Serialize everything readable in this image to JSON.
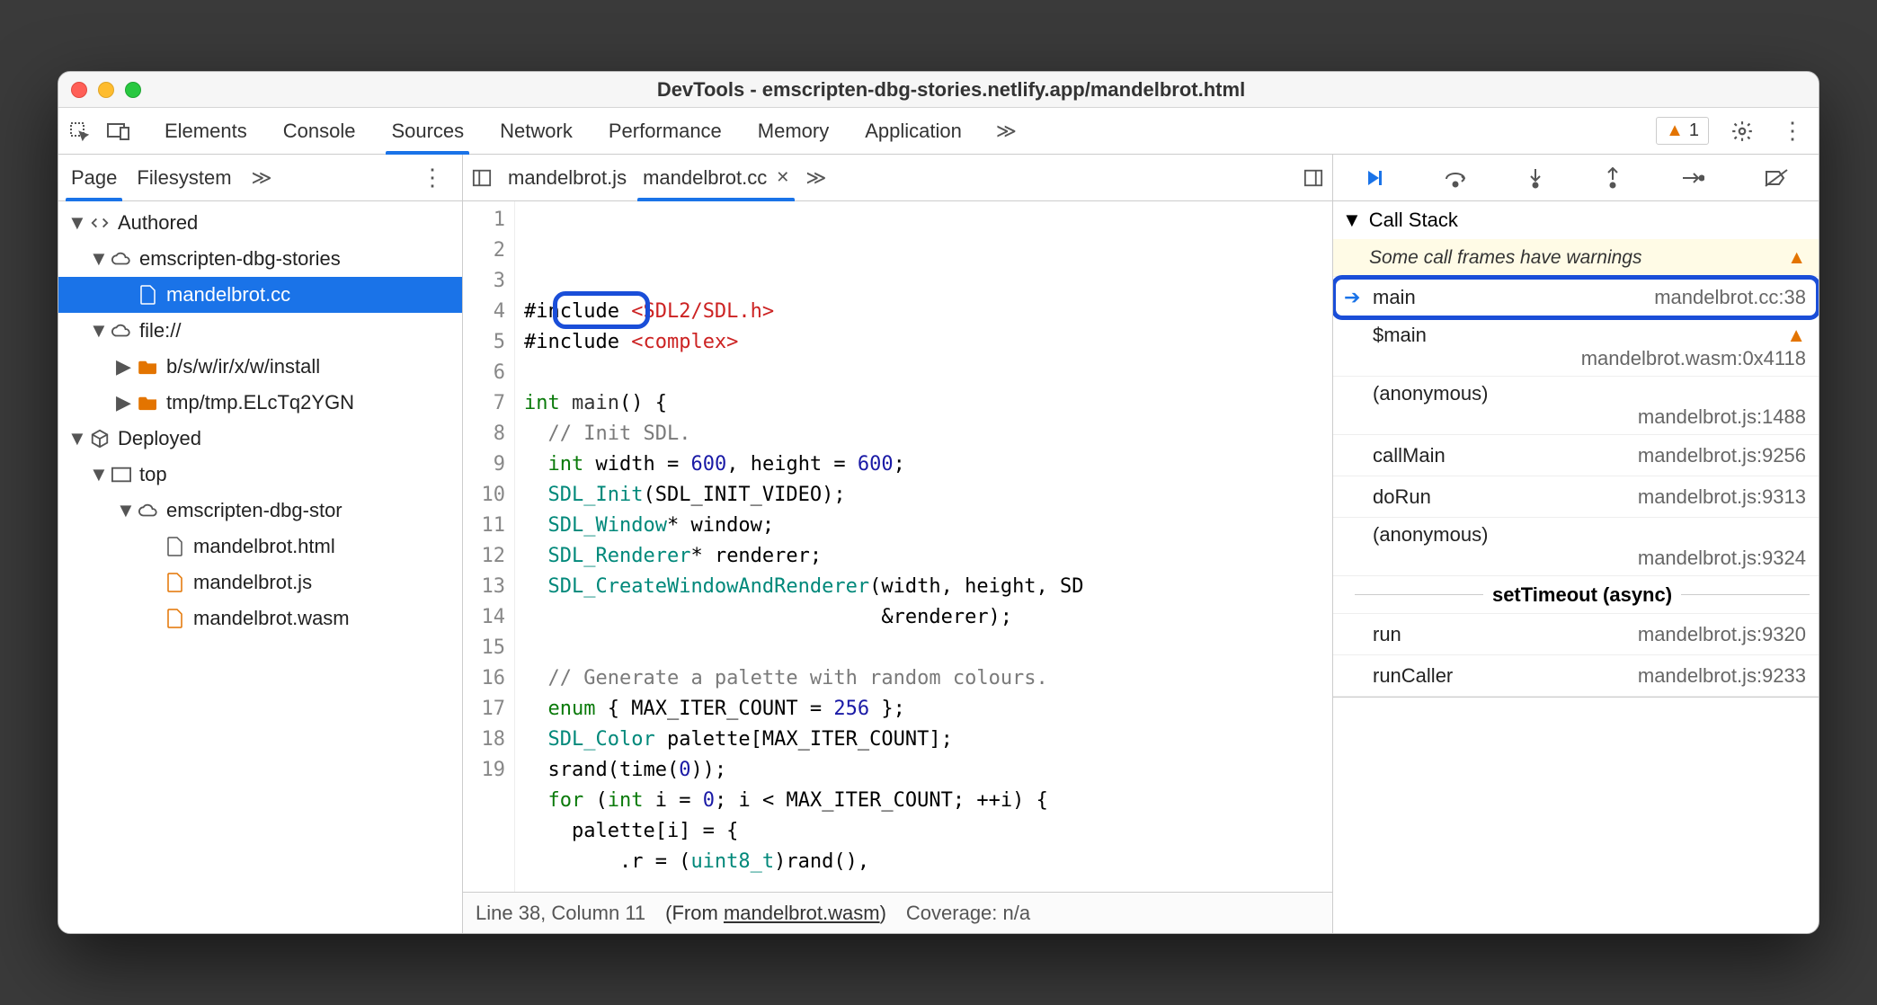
{
  "window": {
    "title": "DevTools - emscripten-dbg-stories.netlify.app/mandelbrot.html"
  },
  "mainTabs": [
    "Elements",
    "Console",
    "Sources",
    "Network",
    "Performance",
    "Memory",
    "Application"
  ],
  "mainTabActive": 2,
  "warnings": {
    "count": "1"
  },
  "leftTabs": [
    "Page",
    "Filesystem"
  ],
  "leftTabActive": 0,
  "tree": {
    "authored": "Authored",
    "origin1": "emscripten-dbg-stories",
    "file1": "mandelbrot.cc",
    "origin2": "file://",
    "folder1": "b/s/w/ir/x/w/install",
    "folder2": "tmp/tmp.ELcTq2YGN",
    "deployed": "Deployed",
    "top": "top",
    "origin3": "emscripten-dbg-stor",
    "dfile1": "mandelbrot.html",
    "dfile2": "mandelbrot.js",
    "dfile3": "mandelbrot.wasm"
  },
  "fileTabs": [
    {
      "label": "mandelbrot.js",
      "active": false,
      "close": false
    },
    {
      "label": "mandelbrot.cc",
      "active": true,
      "close": true
    }
  ],
  "code": {
    "lines": [
      {
        "n": 1,
        "html": "#include <span class='s-pp'>&lt;SDL2/SDL.h&gt;</span>"
      },
      {
        "n": 2,
        "html": "#include <span class='s-pp'>&lt;complex&gt;</span>"
      },
      {
        "n": 3,
        "html": ""
      },
      {
        "n": 4,
        "html": "<span class='s-kw'>int</span> <span class='s-fn'>main</span>() {"
      },
      {
        "n": 5,
        "html": "  <span class='s-cm'>// Init SDL.</span>"
      },
      {
        "n": 6,
        "html": "  <span class='s-kw'>int</span> width = <span class='s-nu'>600</span>, height = <span class='s-nu'>600</span>;"
      },
      {
        "n": 7,
        "html": "  <span class='s-ty'>SDL_Init</span>(SDL_INIT_VIDEO);"
      },
      {
        "n": 8,
        "html": "  <span class='s-ty'>SDL_Window</span>* window;"
      },
      {
        "n": 9,
        "html": "  <span class='s-ty'>SDL_Renderer</span>* renderer;"
      },
      {
        "n": 10,
        "html": "  <span class='s-ty'>SDL_CreateWindowAndRenderer</span>(width, height, SD"
      },
      {
        "n": 11,
        "html": "                              &amp;renderer);"
      },
      {
        "n": 12,
        "html": ""
      },
      {
        "n": 13,
        "html": "  <span class='s-cm'>// Generate a palette with random colours.</span>"
      },
      {
        "n": 14,
        "html": "  <span class='s-kw'>enum</span> { MAX_ITER_COUNT = <span class='s-nu'>256</span> };"
      },
      {
        "n": 15,
        "html": "  <span class='s-ty'>SDL_Color</span> palette[MAX_ITER_COUNT];"
      },
      {
        "n": 16,
        "html": "  srand(time(<span class='s-nu'>0</span>));"
      },
      {
        "n": 17,
        "html": "  <span class='s-kw'>for</span> (<span class='s-kw'>int</span> i = <span class='s-nu'>0</span>; i &lt; MAX_ITER_COUNT; ++i) {"
      },
      {
        "n": 18,
        "html": "    palette[i] = {"
      },
      {
        "n": 19,
        "html": "        .r = (<span class='s-ty'>uint8_t</span>)rand(),"
      }
    ]
  },
  "status": {
    "pos": "Line 38, Column 11",
    "from": "(From ",
    "fromFile": "mandelbrot.wasm",
    "fromEnd": ")",
    "coverage": "Coverage: n/a"
  },
  "callstack": {
    "title": "Call Stack",
    "warning": "Some call frames have warnings",
    "frames": [
      {
        "name": "main",
        "loc": "mandelbrot.cc:38",
        "current": true,
        "boxed": true
      },
      {
        "name": "$main",
        "loc": "mandelbrot.wasm:0x4118",
        "warn": true,
        "twoline": true
      },
      {
        "name": "(anonymous)",
        "loc": "mandelbrot.js:1488",
        "twoline": true
      },
      {
        "name": "callMain",
        "loc": "mandelbrot.js:9256"
      },
      {
        "name": "doRun",
        "loc": "mandelbrot.js:9313"
      },
      {
        "name": "(anonymous)",
        "loc": "mandelbrot.js:9324",
        "twoline": true
      }
    ],
    "async": "setTimeout (async)",
    "frames2": [
      {
        "name": "run",
        "loc": "mandelbrot.js:9320"
      },
      {
        "name": "runCaller",
        "loc": "mandelbrot.js:9233"
      }
    ]
  }
}
